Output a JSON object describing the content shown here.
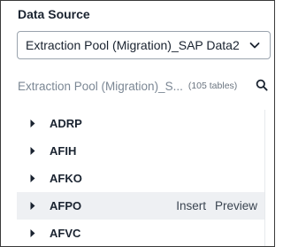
{
  "data_source": {
    "title": "Data Source",
    "selected": "Extraction Pool (Migration)_SAP Data2",
    "icon": "chevron-down-icon"
  },
  "search": {
    "text": "Extraction Pool (Migration)_S...",
    "count": "(105 tables)",
    "icon": "search-icon"
  },
  "tables": [
    {
      "name": "ADRP"
    },
    {
      "name": "AFIH"
    },
    {
      "name": "AFKO"
    },
    {
      "name": "AFPO",
      "hovered": true,
      "insert_label": "Insert",
      "preview_label": "Preview"
    },
    {
      "name": "AFVC"
    }
  ],
  "colors": {
    "hover_row": "#eef0f3",
    "border": "#9aa3ad",
    "text": "#1a2330",
    "muted": "#7b8794"
  }
}
